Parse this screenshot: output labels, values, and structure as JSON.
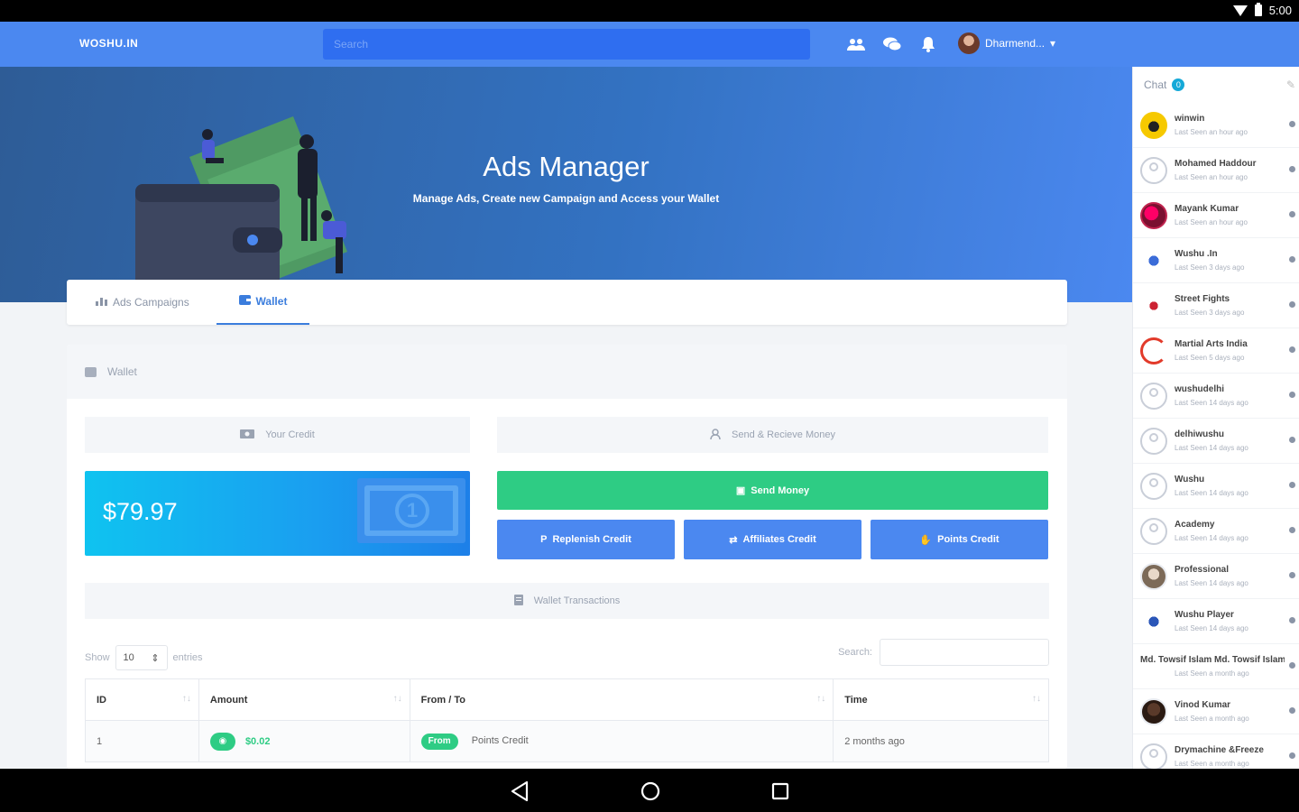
{
  "status_bar": {
    "time": "5:00"
  },
  "topnav": {
    "logo": "WOSHU.IN",
    "search_placeholder": "Search",
    "user_name": "Dharmend...",
    "icons": [
      "users-icon",
      "chat-bubbles-icon",
      "bell-icon"
    ]
  },
  "hero": {
    "title": "Ads Manager",
    "subtitle": "Manage Ads, Create new Campaign and Access your Wallet"
  },
  "tabs": [
    {
      "label": "Ads Campaigns",
      "icon": "chart-icon",
      "active": false
    },
    {
      "label": "Wallet",
      "icon": "wallet-icon",
      "active": true
    }
  ],
  "wallet": {
    "header": "Wallet",
    "your_credit_label": "Your Credit",
    "credit_amount": "$79.97",
    "send_receive_label": "Send & Recieve Money",
    "send_money_label": "Send Money",
    "replenish_label": "Replenish Credit",
    "affiliates_label": "Affiliates Credit",
    "points_label": "Points Credit",
    "transactions_label": "Wallet Transactions",
    "colors": {
      "green": "#2ecc84",
      "blue": "#4b88f0",
      "card_start": "#0fc3f0"
    }
  },
  "datatable": {
    "show_label": "Show",
    "entries_value": "10",
    "entries_label": "entries",
    "search_label": "Search:",
    "columns": [
      "ID",
      "Amount",
      "From / To",
      "Time"
    ],
    "rows": [
      {
        "id": "1",
        "amount": "$0.02",
        "direction": "From",
        "party": "Points Credit",
        "time": "2 months ago"
      }
    ]
  },
  "chat": {
    "title": "Chat",
    "count": "0",
    "users": [
      {
        "name": "winwin",
        "seen": "Last Seen an hour ago"
      },
      {
        "name": "Mohamed Haddour",
        "seen": "Last Seen an hour ago"
      },
      {
        "name": "Mayank Kumar",
        "seen": "Last Seen an hour ago"
      },
      {
        "name": "Wushu .In",
        "seen": "Last Seen 3 days ago"
      },
      {
        "name": "Street Fights",
        "seen": "Last Seen 3 days ago"
      },
      {
        "name": "Martial Arts India",
        "seen": "Last Seen 5 days ago"
      },
      {
        "name": "wushudelhi",
        "seen": "Last Seen 14 days ago"
      },
      {
        "name": "delhiwushu",
        "seen": "Last Seen 14 days ago"
      },
      {
        "name": "Wushu",
        "seen": "Last Seen 14 days ago"
      },
      {
        "name": "Academy",
        "seen": "Last Seen 14 days ago"
      },
      {
        "name": "Professional",
        "seen": "Last Seen 14 days ago"
      },
      {
        "name": "Wushu Player",
        "seen": "Last Seen 14 days ago"
      },
      {
        "name": "Md. Towsif Islam Md. Towsif Islam",
        "seen": "Last Seen a month ago"
      },
      {
        "name": "Vinod Kumar",
        "seen": "Last Seen a month ago"
      },
      {
        "name": "Drymachine &Freeze",
        "seen": "Last Seen a month ago"
      }
    ]
  }
}
